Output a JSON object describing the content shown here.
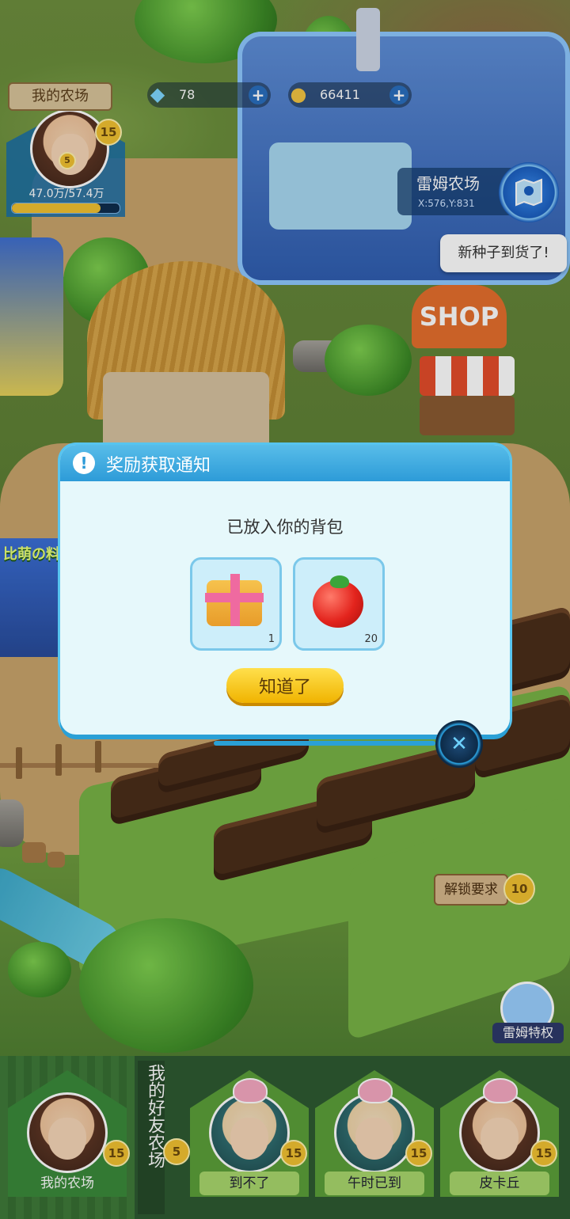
{
  "hud": {
    "farm_tag": "我的农场",
    "gems": "78",
    "gold": "66411",
    "gem_icon": "gem-icon",
    "gold_icon": "cat-coin-icon",
    "player_level": "15",
    "pet_level": "5",
    "exp_text": "47.0万/57.4万",
    "exp_progress": 0.82
  },
  "location": {
    "name": "雷姆农场",
    "coord": "X:576,Y:831"
  },
  "map_button_icon": "map-icon",
  "speech_bubble": "新种子到货了!",
  "shop_sign": "SHOP",
  "kitchen_sign": "比萌の料",
  "unlock": {
    "label": "解锁要求",
    "level": "10"
  },
  "vip_label": "雷姆特权",
  "dialog": {
    "title": "奖励获取通知",
    "message": "已放入你的背包",
    "items": [
      {
        "icon": "gift-box-icon",
        "count": "1"
      },
      {
        "icon": "tomato-icon",
        "count": "20"
      }
    ],
    "ok_label": "知道了",
    "close_icon": "close-icon"
  },
  "friend_bar": {
    "my_farm_label": "我的农场",
    "my_level": "15",
    "friends_title": "我的好友农场",
    "friends": [
      {
        "name": "到不了",
        "level": "15"
      },
      {
        "name": "午时已到",
        "level": "15"
      },
      {
        "name": "皮卡丘",
        "level": "15"
      }
    ],
    "partial_level": "5"
  },
  "colors": {
    "dialog_header": "#2d9bd8",
    "ok_button": "#f0b300",
    "exp_bar": "#f2c232"
  }
}
